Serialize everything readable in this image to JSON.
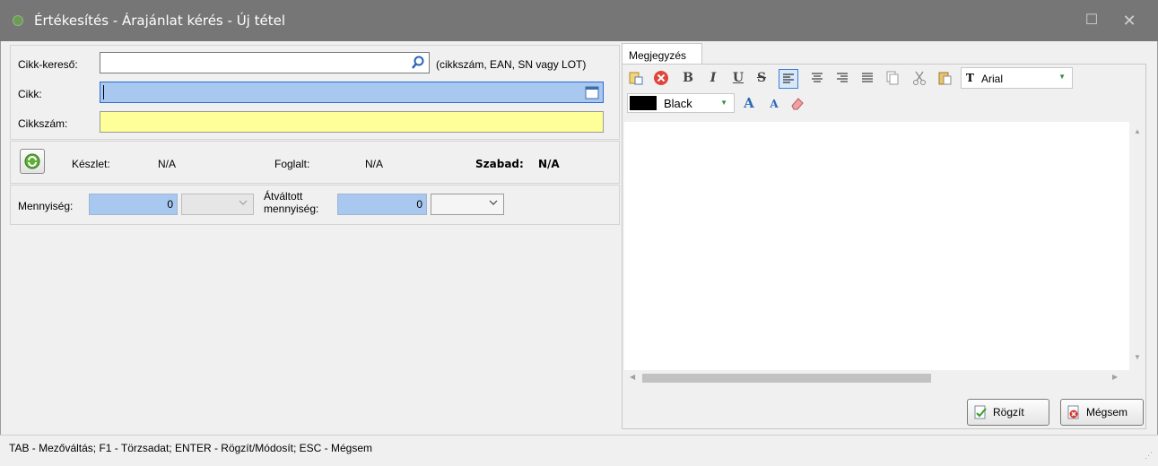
{
  "window": {
    "title": "Értékesítés - Árajánlat kérés - Új tétel"
  },
  "search": {
    "label": "Cikk-kereső:",
    "value": "",
    "hint": "(cikkszám, EAN, SN vagy LOT)"
  },
  "item": {
    "label": "Cikk:",
    "value": ""
  },
  "sku": {
    "label": "Cikkszám:",
    "value": ""
  },
  "stock": {
    "keszlet_label": "Készlet:",
    "keszlet_value": "N/A",
    "foglalt_label": "Foglalt:",
    "foglalt_value": "N/A",
    "szabad_label": "Szabad:",
    "szabad_value": "N/A"
  },
  "quantity": {
    "label": "Mennyiség:",
    "value": "0",
    "converted_label_line1": "Átváltott",
    "converted_label_line2": "mennyiség:",
    "converted_value": "0"
  },
  "notes": {
    "tab_label": "Megjegyzés",
    "font_name": "Arial",
    "color_name": "Black",
    "color_hex": "#000000"
  },
  "buttons": {
    "save": "Rögzít",
    "cancel": "Mégsem"
  },
  "statusbar": {
    "text": "TAB - Mezőváltás; F1 - Törzsadat; ENTER - Rögzít/Módosít; ESC - Mégsem"
  },
  "icons": [
    "app-icon",
    "maximize-icon",
    "close-icon",
    "search-icon",
    "calendar-icon",
    "refresh-icon",
    "chevron-down-icon",
    "paste-format-icon",
    "cancel-icon",
    "bold-icon",
    "italic-icon",
    "underline-icon",
    "strikethrough-icon",
    "align-left-icon",
    "align-center-icon",
    "align-right-icon",
    "justify-icon",
    "copy-icon",
    "cut-icon",
    "paste-icon",
    "font-icon",
    "grow-font-icon",
    "shrink-font-icon",
    "eraser-icon",
    "save-icon",
    "cancel-x-icon",
    "resize-grip-icon"
  ]
}
